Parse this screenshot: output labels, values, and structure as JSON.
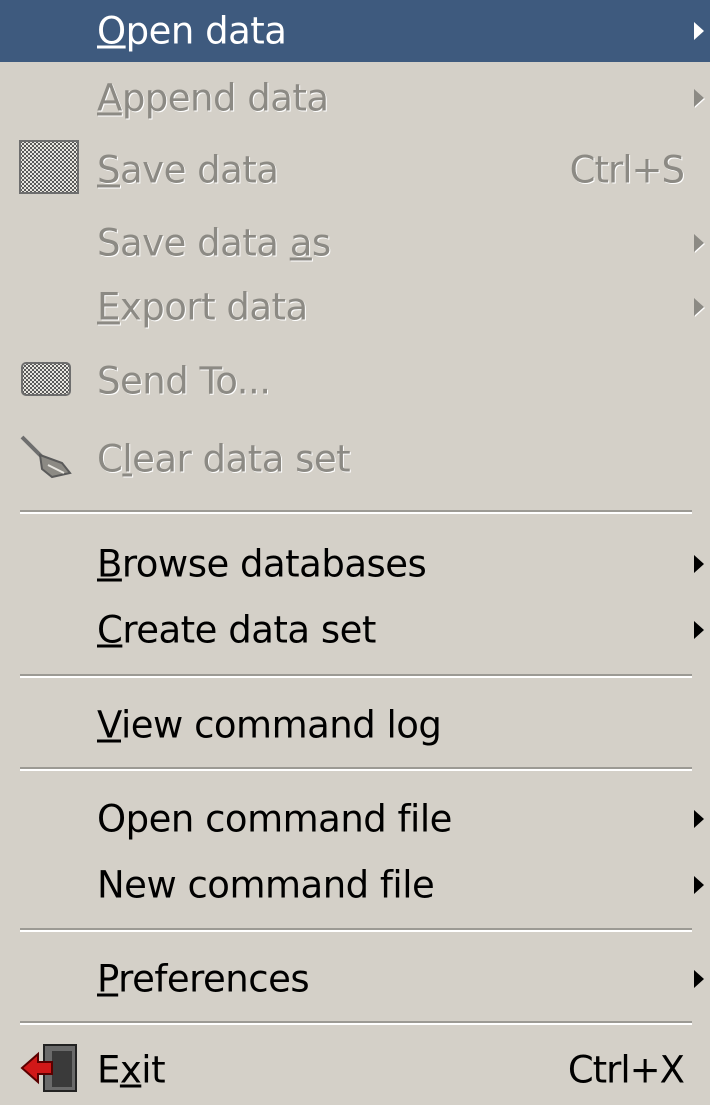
{
  "menu": {
    "items": [
      {
        "label": "Open data",
        "mnemonic": "O",
        "submenu": true,
        "state": "selected"
      },
      {
        "label": "Append data",
        "mnemonic": "A",
        "submenu": true,
        "state": "disabled"
      },
      {
        "label": "Save data",
        "mnemonic": "S",
        "shortcut": "Ctrl+S",
        "icon": "save-icon",
        "state": "disabled"
      },
      {
        "label": "Save data as",
        "mnemonic": "a",
        "submenu": true,
        "state": "disabled"
      },
      {
        "label": "Export data",
        "mnemonic": "E",
        "submenu": true,
        "state": "disabled"
      },
      {
        "label": "Send To...",
        "icon": "send-to-icon",
        "state": "disabled"
      },
      {
        "label": "Clear data set",
        "mnemonic": "l",
        "icon": "broom-icon",
        "state": "disabled"
      },
      {
        "label": "Browse databases",
        "mnemonic": "B",
        "submenu": true,
        "state": "enabled"
      },
      {
        "label": "Create data set",
        "mnemonic": "C",
        "submenu": true,
        "state": "enabled"
      },
      {
        "label": "View command log",
        "mnemonic": "V",
        "state": "enabled"
      },
      {
        "label": "Open command file",
        "submenu": true,
        "state": "enabled"
      },
      {
        "label": "New command file",
        "submenu": true,
        "state": "enabled"
      },
      {
        "label": "Preferences",
        "mnemonic": "P",
        "submenu": true,
        "state": "enabled"
      },
      {
        "label": "Exit",
        "mnemonic": "x",
        "shortcut": "Ctrl+X",
        "icon": "exit-door-icon",
        "state": "enabled"
      }
    ]
  },
  "colors": {
    "menu_background": "#d4d0c8",
    "selection": "#3e5a7e",
    "disabled_text": "#8c8a84"
  }
}
